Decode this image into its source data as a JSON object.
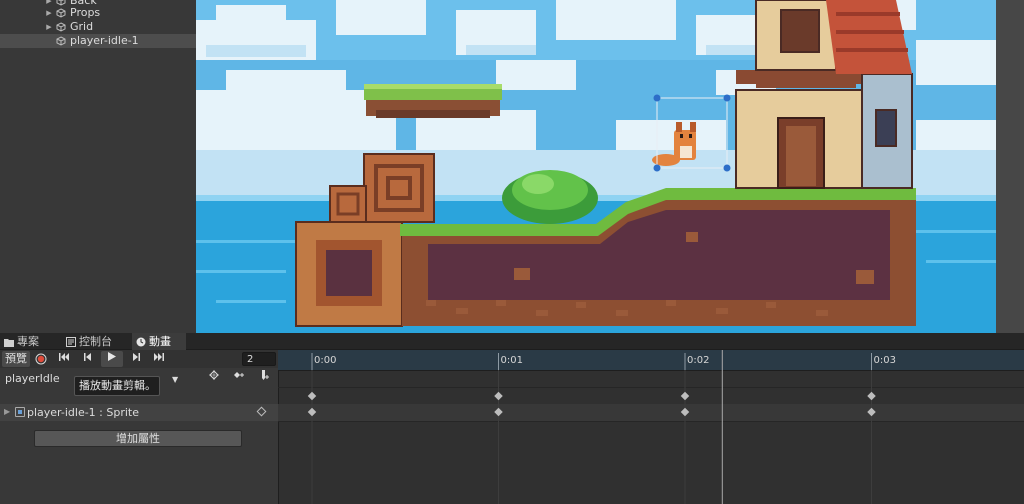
{
  "hierarchy": {
    "items": [
      {
        "label": "Back",
        "collapsed": true
      },
      {
        "label": "Props",
        "collapsed": true
      },
      {
        "label": "Grid",
        "collapsed": true
      },
      {
        "label": "player-idle-1",
        "selected": true
      }
    ]
  },
  "tabs": [
    {
      "label": "專案",
      "icon": "folder-icon"
    },
    {
      "label": "控制台",
      "icon": "console-icon"
    },
    {
      "label": "動畫",
      "icon": "clock-icon",
      "active": true
    }
  ],
  "animation": {
    "preview_label": "預覽",
    "current_frame": "2",
    "clip_name": "playerIdle",
    "tooltip": "播放動畫剪輯。",
    "property_label": "player-idle-1 : Sprite",
    "add_property_label": "增加屬性",
    "timeline": {
      "ticks": [
        "0:00",
        "0:01",
        "0:02",
        "0:03"
      ],
      "keyframes_at": [
        0,
        1,
        2,
        3
      ],
      "playhead_at": 2.2
    }
  },
  "colors": {
    "record": "#e04b3a",
    "accent": "#2d8bd0"
  }
}
